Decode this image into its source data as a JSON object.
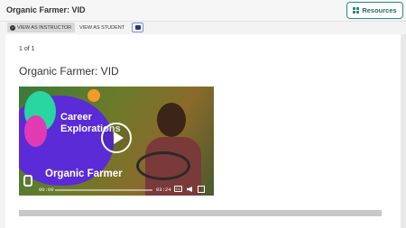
{
  "header": {
    "title": "Organic Farmer: VID",
    "resources_label": "Resources"
  },
  "view_bar": {
    "instructor_label": "VIEW AS INSTRUCTOR",
    "student_label": "VIEW AS STUDENT"
  },
  "content": {
    "pager": "1 of 1",
    "heading": "Organic Farmer: VID",
    "video": {
      "title_line": "Career Explorations",
      "subtitle": "Organic Farmer",
      "current_time": "00:00",
      "duration": "03:24",
      "cc_label": "CC"
    }
  }
}
